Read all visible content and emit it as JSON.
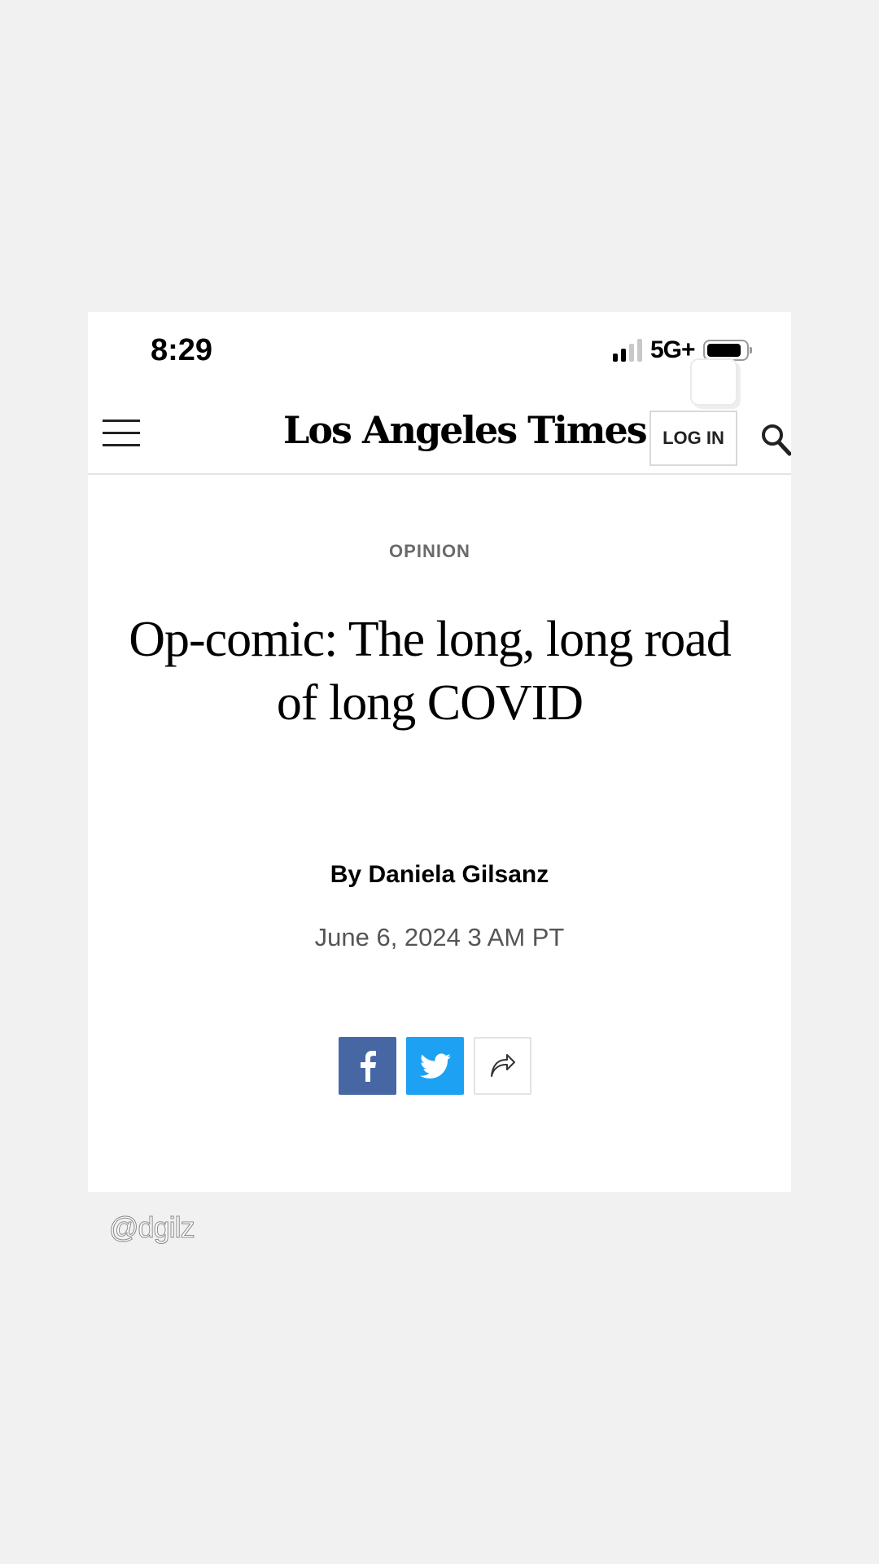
{
  "status_bar": {
    "time": "8:29",
    "network": "5G+",
    "icons": [
      "signal-icon",
      "battery-icon"
    ]
  },
  "header": {
    "logo": "Los Angeles Times",
    "login_label": "LOG IN",
    "icons": [
      "hamburger-menu-icon",
      "search-icon"
    ]
  },
  "article": {
    "section": "OPINION",
    "headline": "Op-comic: The long, long road of long COVID",
    "byline_prefix": "By",
    "author": "Daniela Gilsanz",
    "date": "June 6, 2024 3 AM PT"
  },
  "share": {
    "icons": [
      "facebook-icon",
      "twitter-icon",
      "share-icon"
    ],
    "colors": {
      "facebook": "#4767a4",
      "twitter": "#1da1f2"
    }
  },
  "watermark": "@dgilz"
}
